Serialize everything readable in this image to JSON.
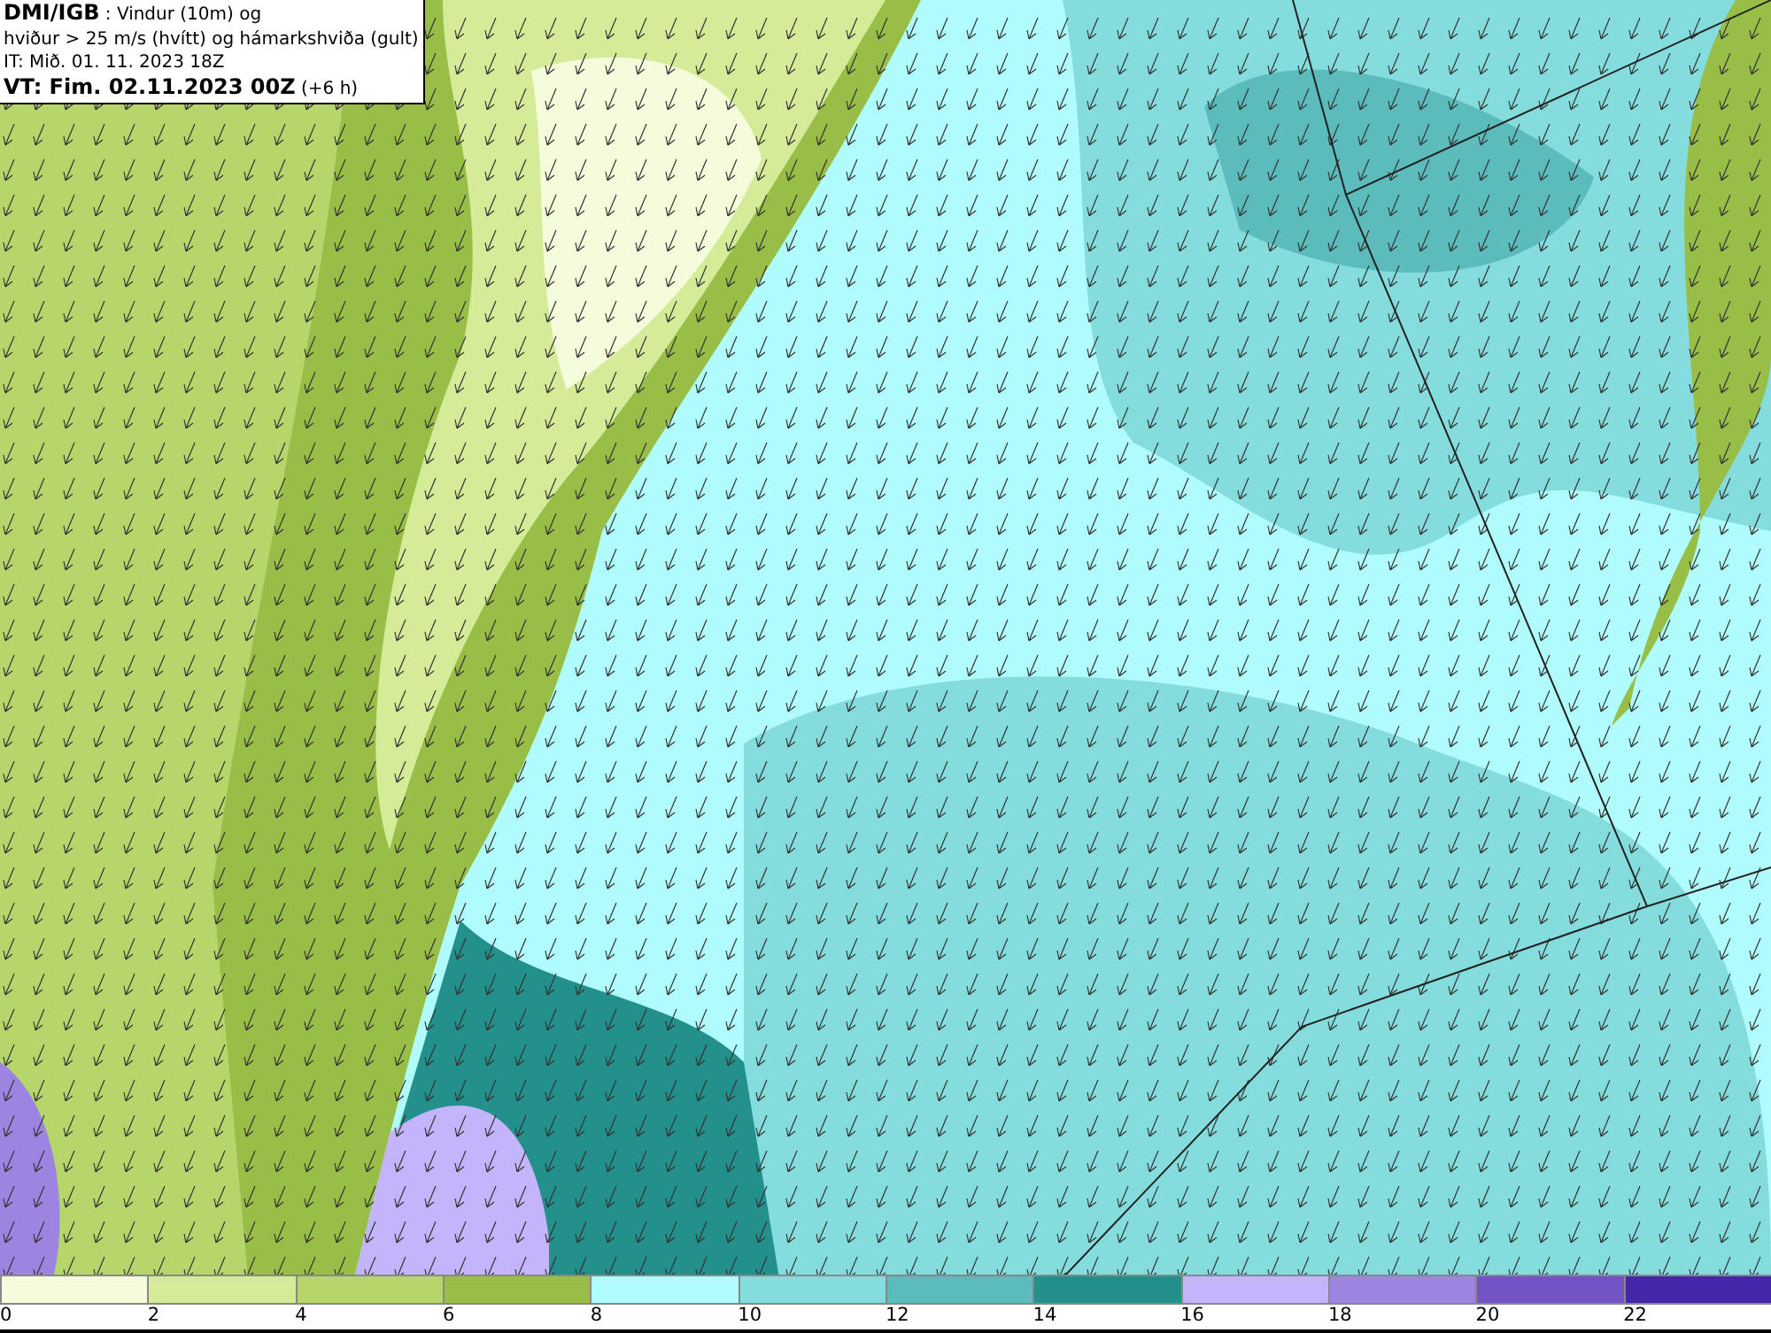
{
  "info_box": {
    "lines": [
      "**DMI/IGB** : Vindur (10m) og",
      "hviður > 25 m/s (hvítt) og hámarkshviða (gult)",
      "IT: Mið. 01. 11. 2023 18Z",
      "**VT: Fim. 02.11.2023 00Z** (+6 h)"
    ]
  },
  "legend": [
    {
      "label": "0",
      "color": "#f4fcdc"
    },
    {
      "label": "2",
      "color": "#d4ec98"
    },
    {
      "label": "4",
      "color": "#b6d66c"
    },
    {
      "label": "6",
      "color": "#98be48"
    },
    {
      "label": "8",
      "color": "#b0fcfc"
    },
    {
      "label": "10",
      "color": "#84dcdc"
    },
    {
      "label": "12",
      "color": "#5cbcbc"
    },
    {
      "label": "14",
      "color": "#24908c"
    },
    {
      "label": "16",
      "color": "#c4b4fc"
    },
    {
      "label": "18",
      "color": "#9c84e0"
    },
    {
      "label": "20",
      "color": "#7454c4"
    },
    {
      "label": "22",
      "color": "#4428a8"
    }
  ]
}
